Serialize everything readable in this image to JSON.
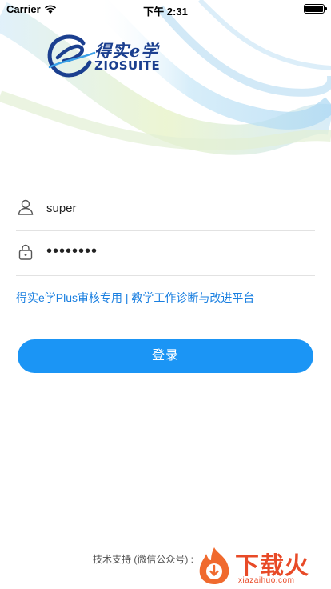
{
  "status_bar": {
    "carrier": "Carrier",
    "time": "下午 2:31"
  },
  "logo": {
    "title": "得实e学",
    "subtitle": "ZIOSUITE"
  },
  "form": {
    "username": "super",
    "password_masked": "••••••••"
  },
  "banner": "得实e学Plus审核专用 | 教学工作诊断与改进平台",
  "login_button": "登录",
  "support_text": "技术支持 (微信公众号) :",
  "watermark": {
    "name": "下载火",
    "url": "xiazaihuo.com"
  },
  "colors": {
    "accent": "#1b95f5",
    "link": "#1a7fe0",
    "logo": "#1b3f8f",
    "watermark": "#e84a27"
  }
}
